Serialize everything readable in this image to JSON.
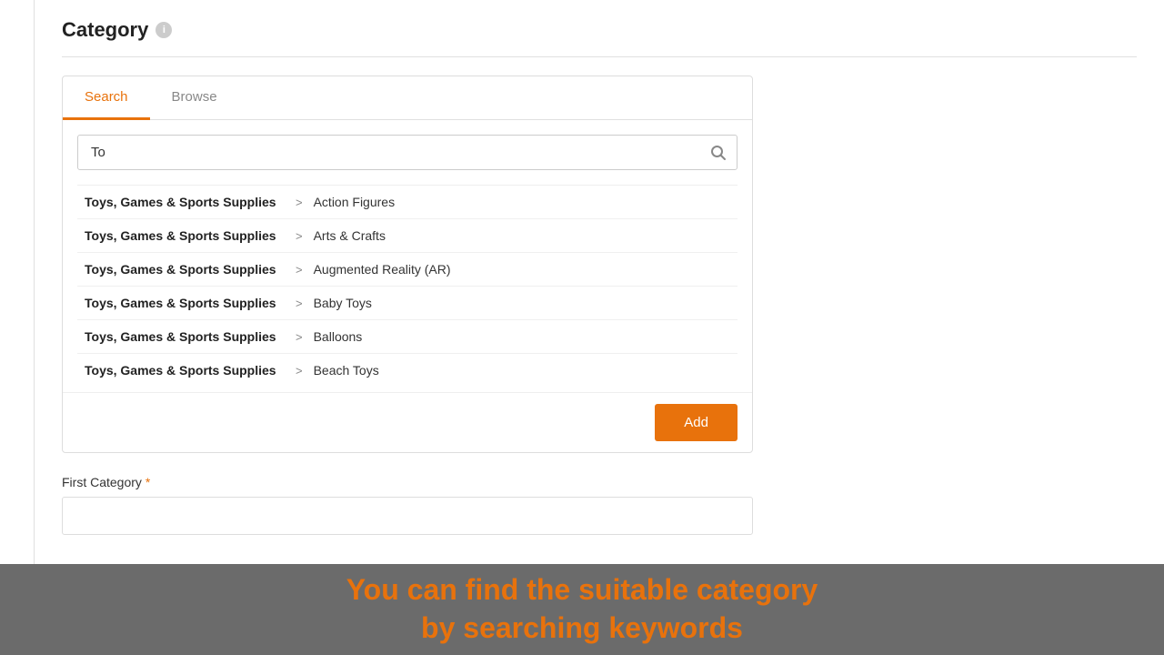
{
  "page": {
    "title": "Category",
    "info_icon_label": "i"
  },
  "tabs": [
    {
      "id": "search",
      "label": "Search",
      "active": true
    },
    {
      "id": "browse",
      "label": "Browse",
      "active": false
    }
  ],
  "search": {
    "placeholder": "",
    "value": "To",
    "icon": "🔍"
  },
  "results": [
    {
      "parent": "Toys, Games & Sports Supplies",
      "arrow": ">",
      "child": "Action Figures"
    },
    {
      "parent": "Toys, Games & Sports Supplies",
      "arrow": ">",
      "child": "Arts & Crafts"
    },
    {
      "parent": "Toys, Games & Sports Supplies",
      "arrow": ">",
      "child": "Augmented Reality (AR)"
    },
    {
      "parent": "Toys, Games & Sports Supplies",
      "arrow": ">",
      "child": "Baby Toys"
    },
    {
      "parent": "Toys, Games & Sports Supplies",
      "arrow": ">",
      "child": "Balloons"
    },
    {
      "parent": "Toys, Games & Sports Supplies",
      "arrow": ">",
      "child": "Beach Toys"
    }
  ],
  "footer": {
    "add_button_label": "Add"
  },
  "first_category": {
    "label": "First Category",
    "required": true,
    "value": ""
  },
  "banner": {
    "line1": "You can find the suitable category",
    "line2": "by searching keywords"
  }
}
